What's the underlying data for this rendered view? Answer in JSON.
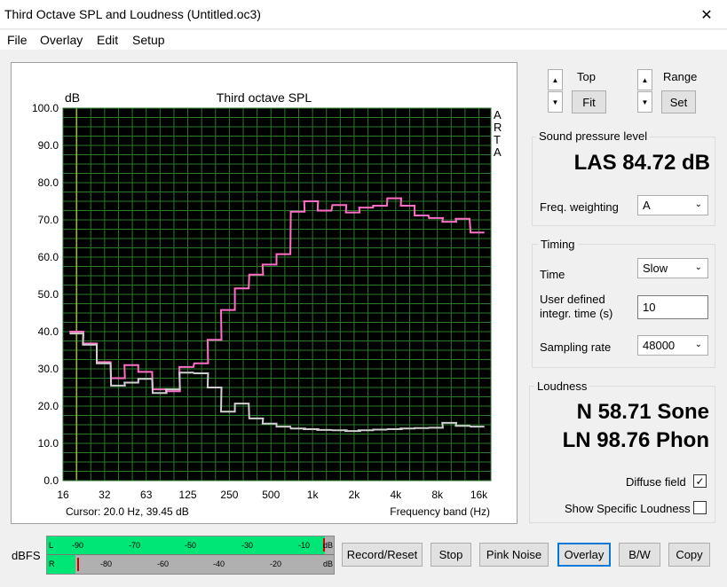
{
  "window": {
    "title": "Third Octave SPL and Loudness (Untitled.oc3)",
    "close_glyph": "✕"
  },
  "menu": {
    "file": "File",
    "overlay": "Overlay",
    "edit": "Edit",
    "setup": "Setup"
  },
  "plot": {
    "title": "Third octave SPL",
    "unit": "dB",
    "side_letters": [
      "A",
      "R",
      "T",
      "A"
    ],
    "cursor_text": "Cursor:    20.0 Hz, 39.45 dB",
    "xlabel": "Frequency band (Hz)"
  },
  "chart_data": {
    "type": "line",
    "title": "Third octave SPL",
    "ylabel": "dB",
    "xlabel": "Frequency band (Hz)",
    "y_ticks": [
      "100.0",
      "90.0",
      "80.0",
      "70.0",
      "60.0",
      "50.0",
      "40.0",
      "30.0",
      "20.0",
      "10.0",
      "0.0"
    ],
    "x_ticks": [
      "16",
      "32",
      "63",
      "125",
      "250",
      "500",
      "1k",
      "2k",
      "4k",
      "8k",
      "16k"
    ],
    "ylim": [
      0,
      100
    ],
    "x_scale": "log (third-octave bands)",
    "grid": true,
    "background": "#000000",
    "grid_color": "#2a7a2a",
    "cursor_frequency_hz": 20,
    "bands_hz": [
      20,
      25,
      31.5,
      40,
      50,
      63,
      80,
      100,
      125,
      160,
      200,
      250,
      315,
      400,
      500,
      630,
      800,
      1000,
      1250,
      1600,
      2000,
      2500,
      3150,
      4000,
      5000,
      6300,
      8000,
      10000,
      12500,
      16000
    ],
    "series": [
      {
        "color": "#ff6ec7",
        "values": [
          40.0,
          36.8,
          31.8,
          27.5,
          31.0,
          29.2,
          24.5,
          24.0,
          30.5,
          31.5,
          37.8,
          45.8,
          51.6,
          55.3,
          58.0,
          60.8,
          72.2,
          75.0,
          72.5,
          74.0,
          72.0,
          73.3,
          73.8,
          75.8,
          73.8,
          71.2,
          70.5,
          69.5,
          70.3,
          66.6
        ]
      },
      {
        "color": "#cfcfcf",
        "values": [
          39.5,
          36.5,
          31.5,
          25.5,
          26.3,
          27.3,
          23.5,
          24.5,
          29.0,
          28.8,
          25.0,
          18.5,
          20.7,
          16.7,
          15.3,
          14.5,
          14.0,
          13.8,
          13.6,
          13.5,
          13.3,
          13.5,
          13.7,
          13.8,
          14.0,
          14.1,
          14.2,
          15.5,
          14.7,
          14.5
        ]
      }
    ]
  },
  "controls": {
    "top_label": "Top",
    "range_label": "Range",
    "fit_button": "Fit",
    "set_button": "Set",
    "spin_up": "▲",
    "spin_down": "▼"
  },
  "spl": {
    "group_title": "Sound pressure level",
    "reading": "LAS 84.72 dB",
    "freq_weighting_label": "Freq. weighting",
    "freq_weighting_value": "A"
  },
  "timing": {
    "group_title": "Timing",
    "time_label": "Time",
    "time_value": "Slow",
    "user_defined_label_1": "User defined",
    "user_defined_label_2": "integr. time (s)",
    "user_defined_value": "10",
    "sampling_rate_label": "Sampling rate",
    "sampling_rate_value": "48000",
    "combo_arrow": "⌄"
  },
  "loudness": {
    "group_title": "Loudness",
    "sone": "N 58.71 Sone",
    "phon": "LN 98.76 Phon",
    "diffuse_field_label": "Diffuse field",
    "diffuse_field_checked": true,
    "check_glyph": "✓",
    "show_specific_label": "Show Specific Loudness",
    "show_specific_checked": false
  },
  "meter": {
    "label": "dBFS",
    "top_channel": "L",
    "bottom_channel": "R",
    "top_ticks": [
      "-90",
      "-70",
      "-50",
      "-30",
      "-10",
      "dB"
    ],
    "bottom_ticks": [
      "-80",
      "-60",
      "-40",
      "-20",
      "dB"
    ],
    "left_level_fraction": 0.97,
    "right_level_fraction": 0.1
  },
  "bottom_buttons": {
    "record_reset": "Record/Reset",
    "stop": "Stop",
    "pink_noise": "Pink Noise",
    "overlay": "Overlay",
    "bw": "B/W",
    "copy": "Copy"
  },
  "colors": {
    "accent_focus": "#0078d7",
    "meter_green": "#00e676",
    "peak_red": "#d00000",
    "cursor_line": "#e5e500"
  }
}
